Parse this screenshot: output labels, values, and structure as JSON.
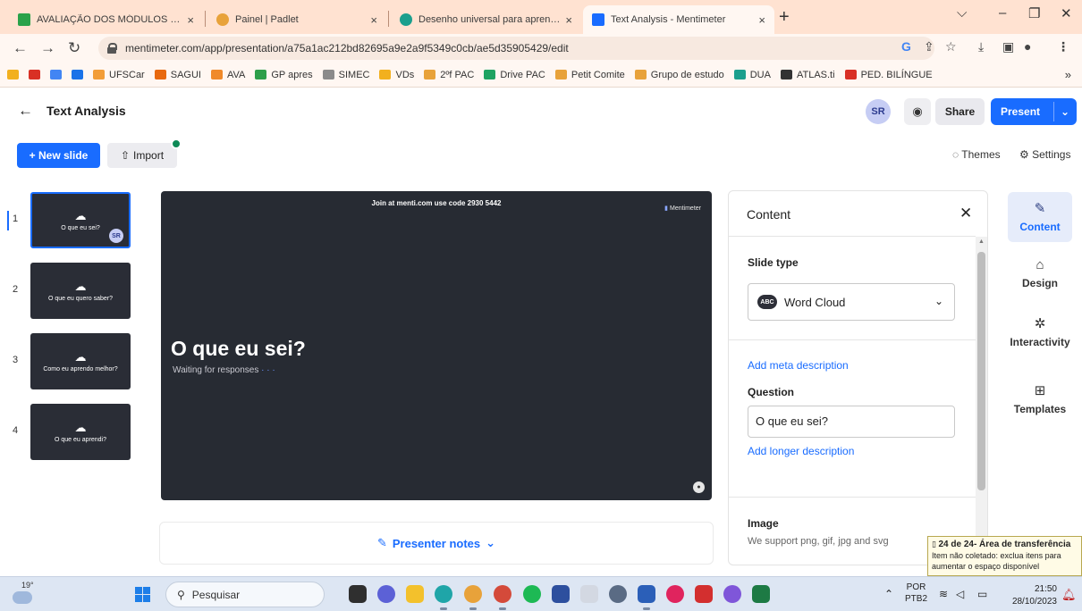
{
  "browser": {
    "tabs": [
      {
        "title": "AVALIAÇÃO DOS MÓDULOS - G",
        "color": "#2aa24a"
      },
      {
        "title": "Painel | Padlet",
        "color": "#e8a23a"
      },
      {
        "title": "Desenho universal para aprendiz",
        "color": "#1b9f8d"
      },
      {
        "title": "Text Analysis - Mentimeter",
        "color": "#196cff"
      }
    ],
    "url": "mentimeter.com/app/presentation/a75a1ac212bd82695a9e2a9f5349c0cb/ae5d35905429/edit",
    "bookmarks": [
      {
        "label": "",
        "color": "#f2b01e"
      },
      {
        "label": "",
        "color": "#d93025"
      },
      {
        "label": "",
        "color": "#4285f4"
      },
      {
        "label": "",
        "color": "#1a73e8"
      },
      {
        "label": "UFSCar",
        "color": "#f29d38"
      },
      {
        "label": "SAGUI",
        "color": "#e8690f"
      },
      {
        "label": "AVA",
        "color": "#f08a2a"
      },
      {
        "label": "GP apres",
        "color": "#2d9f4a"
      },
      {
        "label": "SIMEC",
        "color": "#8b8b8b"
      },
      {
        "label": "VDs",
        "color": "#f2b01e"
      },
      {
        "label": "2ºf PAC",
        "color": "#e8a23a"
      },
      {
        "label": "Drive PAC",
        "color": "#1ea362"
      },
      {
        "label": "Petit Comite",
        "color": "#e8a23a"
      },
      {
        "label": "Grupo de estudo",
        "color": "#e8a23a"
      },
      {
        "label": "DUA",
        "color": "#1b9f8d"
      },
      {
        "label": "ATLAS.ti",
        "color": "#333333"
      },
      {
        "label": "PED. BILÍNGUE",
        "color": "#d93025"
      }
    ]
  },
  "app": {
    "title": "Text Analysis",
    "avatar": "SR",
    "share_label": "Share",
    "present_label": "Present",
    "new_slide_label": "+ New slide",
    "import_label": "Import",
    "themes_label": "Themes",
    "settings_label": "Settings",
    "accent": "#196cff"
  },
  "slides": [
    {
      "num": "1",
      "title": "O que eu sei?",
      "badge": "SR"
    },
    {
      "num": "2",
      "title": "O que eu quero saber?"
    },
    {
      "num": "3",
      "title": "Como eu aprendo melhor?"
    },
    {
      "num": "4",
      "title": "O que eu aprendi?"
    }
  ],
  "canvas": {
    "join_text": "Join at menti.com use code 2930 5442",
    "brand": "Mentimeter",
    "question": "O que eu sei?",
    "waiting": "Waiting for responses",
    "waiting_dots": " · · ·"
  },
  "notes_label": "Presenter notes",
  "panel": {
    "title": "Content",
    "slide_type_label": "Slide type",
    "slide_type_value": "Word Cloud",
    "add_meta": "Add meta description",
    "question_label": "Question",
    "question_value": "O que eu sei?",
    "add_longer": "Add longer description",
    "image_label": "Image",
    "image_hint": "We support png, gif, jpg and svg"
  },
  "rail": [
    {
      "label": "Content",
      "icon": "pen-icon"
    },
    {
      "label": "Design",
      "icon": "brush-icon"
    },
    {
      "label": "Interactivity",
      "icon": "sparkle-icon"
    },
    {
      "label": "Templates",
      "icon": "grid-icon"
    }
  ],
  "toast": {
    "title": "24 de 24- Área de transferência",
    "line1": "Item não coletado: exclua itens para",
    "line2": "aumentar o espaço disponível"
  },
  "taskbar": {
    "temp": "19°",
    "search_placeholder": "Pesquisar",
    "lang1": "POR",
    "lang2": "PTB2",
    "time": "21:50",
    "date": "28/10/2023"
  }
}
